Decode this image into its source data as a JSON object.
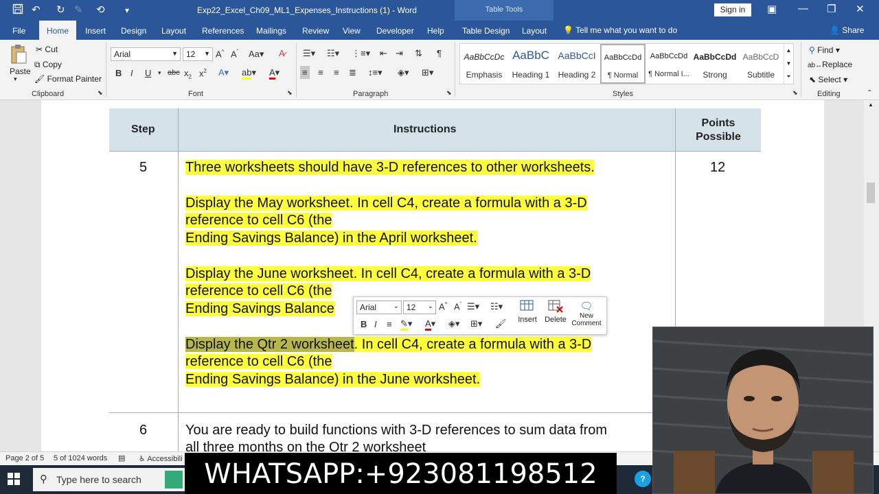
{
  "titlebar": {
    "doc_title": "Exp22_Excel_Ch09_ML1_Expenses_Instructions (1)  -  Word",
    "context_tools": "Table Tools",
    "sign_in": "Sign in"
  },
  "tabs": [
    "File",
    "Home",
    "Insert",
    "Design",
    "Layout",
    "References",
    "Mailings",
    "Review",
    "View",
    "Developer",
    "Help",
    "Table Design",
    "Layout"
  ],
  "tell_me": "Tell me what you want to do",
  "share": "Share",
  "ribbon": {
    "clipboard": {
      "paste": "Paste",
      "cut": "Cut",
      "copy": "Copy",
      "format_painter": "Format Painter",
      "label": "Clipboard"
    },
    "font": {
      "family": "Arial",
      "size": "12",
      "label": "Font"
    },
    "paragraph": {
      "label": "Paragraph"
    },
    "styles": {
      "label": "Styles",
      "items": [
        {
          "preview": "AaBbCcDc",
          "name": "Emphasis"
        },
        {
          "preview": "AaBbC",
          "name": "Heading 1"
        },
        {
          "preview": "AaBbCcI",
          "name": "Heading 2"
        },
        {
          "preview": "AaBbCcDd",
          "name": "¶ Normal"
        },
        {
          "preview": "AaBbCcDd",
          "name": "¶ Normal I..."
        },
        {
          "preview": "AaBbCcDd",
          "name": "Strong"
        },
        {
          "preview": "AaBbCcD",
          "name": "Subtitle"
        }
      ]
    },
    "editing": {
      "find": "Find",
      "replace": "Replace",
      "select": "Select",
      "label": "Editing"
    }
  },
  "table": {
    "headers": {
      "step": "Step",
      "instructions": "Instructions",
      "points": "Points Possible"
    },
    "row5": {
      "step": "5",
      "points": "12",
      "lines": [
        "Three worksheets should have 3-D references to other worksheets.",
        "Display the May worksheet. In cell C4, create a formula with a 3-D",
        "reference to cell C6 (the",
        "Ending Savings Balance) in the April worksheet.",
        "Display the June worksheet. In cell C4, create a formula with a 3-D",
        "reference to cell C6 (the",
        "Ending Savings Balance",
        "Display the Qtr 2 worksheet",
        ". In cell C4, create a formula with a 3-D",
        "reference to cell C6 (the",
        "Ending Savings Balance) in the June worksheet."
      ]
    },
    "row6": {
      "step": "6",
      "lines": [
        "You are ready to build functions with 3-D references to sum data from",
        "all three months on the Qtr 2 worksheet"
      ]
    }
  },
  "minibar": {
    "font": "Arial",
    "size": "12",
    "insert": "Insert",
    "delete": "Delete",
    "new_comment": "New Comment"
  },
  "status": {
    "page": "Page 2 of 5",
    "words": "5 of 1024 words",
    "accessibility": "Accessibili"
  },
  "taskbar": {
    "search_placeholder": "Type here to search"
  },
  "overlay": {
    "whatsapp": "WHATSAPP:+923081198512"
  },
  "colors": {
    "brand": "#2b579a",
    "highlight": "#ffff3b",
    "header_fill": "#d6e2ea"
  }
}
